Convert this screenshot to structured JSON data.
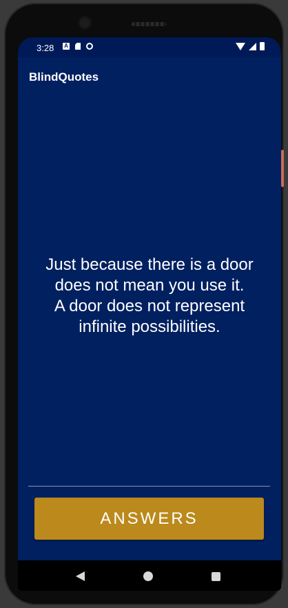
{
  "status_bar": {
    "time": "3:28",
    "left_icons": [
      "a-notification-icon",
      "sd-card-icon",
      "sync-icon"
    ],
    "right_icons": [
      "wifi-icon",
      "signal-icon",
      "battery-icon"
    ]
  },
  "app": {
    "title": "BlindQuotes",
    "quote": "Just because there is a door\ndoes not mean you use it.\nA door does not represent\ninfinite possibilities.",
    "answers_label": "ANSWERS"
  },
  "nav_bar": {
    "icons": [
      "back-icon",
      "home-icon",
      "recents-icon"
    ]
  },
  "colors": {
    "app_background": "#002060",
    "status_bar": "#001a57",
    "button": "#bb891c",
    "text": "#ffffff"
  }
}
